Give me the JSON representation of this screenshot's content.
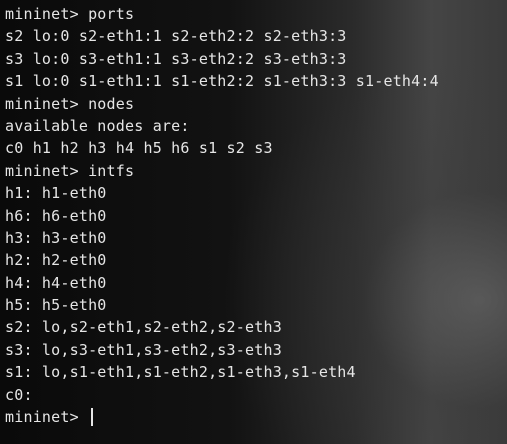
{
  "terminal": {
    "lines": [
      "mininet> ports",
      "s2 lo:0 s2-eth1:1 s2-eth2:2 s2-eth3:3",
      "s3 lo:0 s3-eth1:1 s3-eth2:2 s3-eth3:3",
      "s1 lo:0 s1-eth1:1 s1-eth2:2 s1-eth3:3 s1-eth4:4",
      "mininet> nodes",
      "available nodes are:",
      "c0 h1 h2 h3 h4 h5 h6 s1 s2 s3",
      "mininet> intfs",
      "h1: h1-eth0",
      "h6: h6-eth0",
      "h3: h3-eth0",
      "h2: h2-eth0",
      "h4: h4-eth0",
      "h5: h5-eth0",
      "s2: lo,s2-eth1,s2-eth2,s2-eth3",
      "s3: lo,s3-eth1,s3-eth2,s3-eth3",
      "s1: lo,s1-eth1,s1-eth2,s1-eth3,s1-eth4",
      "c0:"
    ],
    "prompt": "mininet> ",
    "input_value": ""
  },
  "colors": {
    "foreground": "#e6e6e6",
    "background": "#0c0c0c"
  }
}
